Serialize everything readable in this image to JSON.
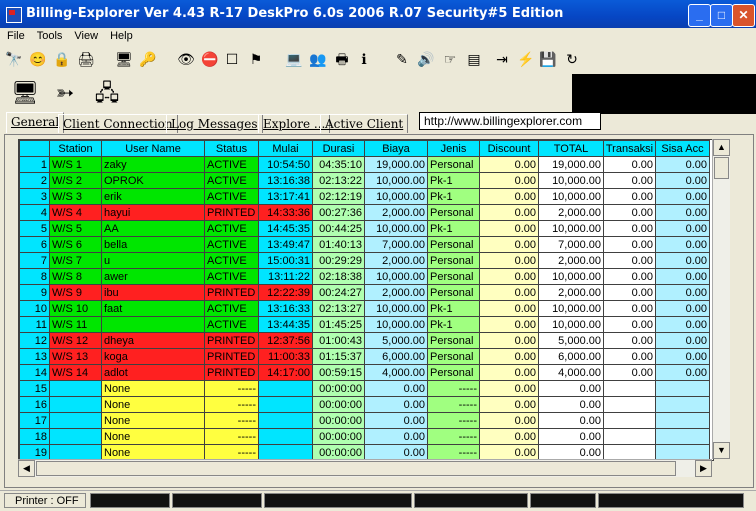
{
  "window": {
    "title": "Billing-Explorer Ver 4.43 R-17 DeskPro 6.0s 2006 R.07 Security#5 Edition",
    "minimize": "_",
    "maximize": "□",
    "close": "✕"
  },
  "menu": [
    "File",
    "Tools",
    "View",
    "Help"
  ],
  "toolbar_icons": [
    "binoculars-icon",
    "smiley-icon",
    "lock-icon",
    "printer-icon",
    "computer-tools-icon",
    "key-icon",
    "eye-icon",
    "stop-icon",
    "square-icon",
    "flag-icon",
    "computer-icon",
    "people-icon",
    "printer-icon",
    "info-icon",
    "pen-icon",
    "speaker-icon",
    "hand-icon",
    "stack-icon",
    "login-icon",
    "lightning-icon",
    "drive-icon",
    "refresh-icon"
  ],
  "big_icons": [
    "server-icon",
    "connection-icon",
    "network-clients-icon"
  ],
  "tabs": [
    "General",
    "Client Connection",
    "Log Messages",
    "Explore ...",
    "Active Client"
  ],
  "url": "http://www.billingexplorer.com",
  "table": {
    "headers": [
      "Station",
      "User Name",
      "Status",
      "Mulai",
      "Durasi",
      "Biaya",
      "Jenis",
      "Discount",
      "TOTAL",
      "Transaksi",
      "Sisa Acc"
    ],
    "rows": [
      [
        "1",
        "W/S 1",
        "zaky",
        "ACTIVE",
        "10:54:50",
        "04:35:10",
        "19,000.00",
        "Personal",
        "0.00",
        "19,000.00",
        "0.00",
        "0.00"
      ],
      [
        "2",
        "W/S 2",
        "OPROK",
        "ACTIVE",
        "13:16:38",
        "02:13:22",
        "10,000.00",
        "Pk-1",
        "0.00",
        "10,000.00",
        "0.00",
        "0.00"
      ],
      [
        "3",
        "W/S 3",
        "erik",
        "ACTIVE",
        "13:17:41",
        "02:12:19",
        "10,000.00",
        "Pk-1",
        "0.00",
        "10,000.00",
        "0.00",
        "0.00"
      ],
      [
        "4",
        "W/S 4",
        "hayui",
        "PRINTED",
        "14:33:36",
        "00:27:36",
        "2,000.00",
        "Personal",
        "0.00",
        "2,000.00",
        "0.00",
        "0.00"
      ],
      [
        "5",
        "W/S 5",
        "AA",
        "ACTIVE",
        "14:45:35",
        "00:44:25",
        "10,000.00",
        "Pk-1",
        "0.00",
        "10,000.00",
        "0.00",
        "0.00"
      ],
      [
        "6",
        "W/S 6",
        "bella",
        "ACTIVE",
        "13:49:47",
        "01:40:13",
        "7,000.00",
        "Personal",
        "0.00",
        "7,000.00",
        "0.00",
        "0.00"
      ],
      [
        "7",
        "W/S 7",
        "u",
        "ACTIVE",
        "15:00:31",
        "00:29:29",
        "2,000.00",
        "Personal",
        "0.00",
        "2,000.00",
        "0.00",
        "0.00"
      ],
      [
        "8",
        "W/S 8",
        "awer",
        "ACTIVE",
        "13:11:22",
        "02:18:38",
        "10,000.00",
        "Personal",
        "0.00",
        "10,000.00",
        "0.00",
        "0.00"
      ],
      [
        "9",
        "W/S 9",
        "ibu",
        "PRINTED",
        "12:22:39",
        "00:24:27",
        "2,000.00",
        "Personal",
        "0.00",
        "2,000.00",
        "0.00",
        "0.00"
      ],
      [
        "10",
        "W/S 10",
        "faat",
        "ACTIVE",
        "13:16:33",
        "02:13:27",
        "10,000.00",
        "Pk-1",
        "0.00",
        "10,000.00",
        "0.00",
        "0.00"
      ],
      [
        "11",
        "W/S 11",
        "",
        "ACTIVE",
        "13:44:35",
        "01:45:25",
        "10,000.00",
        "Pk-1",
        "0.00",
        "10,000.00",
        "0.00",
        "0.00"
      ],
      [
        "12",
        "W/S 12",
        "dheya",
        "PRINTED",
        "12:37:56",
        "01:00:43",
        "5,000.00",
        "Personal",
        "0.00",
        "5,000.00",
        "0.00",
        "0.00"
      ],
      [
        "13",
        "W/S 13",
        "koga",
        "PRINTED",
        "11:00:33",
        "01:15:37",
        "6,000.00",
        "Personal",
        "0.00",
        "6,000.00",
        "0.00",
        "0.00"
      ],
      [
        "14",
        "W/S 14",
        "adlot",
        "PRINTED",
        "14:17:00",
        "00:59:15",
        "4,000.00",
        "Personal",
        "0.00",
        "4,000.00",
        "0.00",
        "0.00"
      ],
      [
        "15",
        "",
        "None",
        "-----",
        "",
        "00:00:00",
        "0.00",
        "-----",
        "0.00",
        "0.00",
        "",
        ""
      ],
      [
        "16",
        "",
        "None",
        "-----",
        "",
        "00:00:00",
        "0.00",
        "-----",
        "0.00",
        "0.00",
        "",
        ""
      ],
      [
        "17",
        "",
        "None",
        "-----",
        "",
        "00:00:00",
        "0.00",
        "-----",
        "0.00",
        "0.00",
        "",
        ""
      ],
      [
        "18",
        "",
        "None",
        "-----",
        "",
        "00:00:00",
        "0.00",
        "-----",
        "0.00",
        "0.00",
        "",
        ""
      ],
      [
        "19",
        "",
        "None",
        "-----",
        "",
        "00:00:00",
        "0.00",
        "-----",
        "0.00",
        "0.00",
        "",
        ""
      ]
    ]
  },
  "status": {
    "printer": "Printer : OFF"
  },
  "colors": {
    "active": "#00e600",
    "printed": "#ff2020",
    "idle": "#ffff40",
    "header": "#00e5ff",
    "mulai": "#00e5ff",
    "durasi": "#b0ffb0",
    "biaya": "#b0f0ff",
    "jenis": "#a0ff80",
    "discount": "#ffffc0",
    "total": "#ffffff",
    "transaksi": "#ffffff",
    "sisa": "#b0f0ff"
  }
}
